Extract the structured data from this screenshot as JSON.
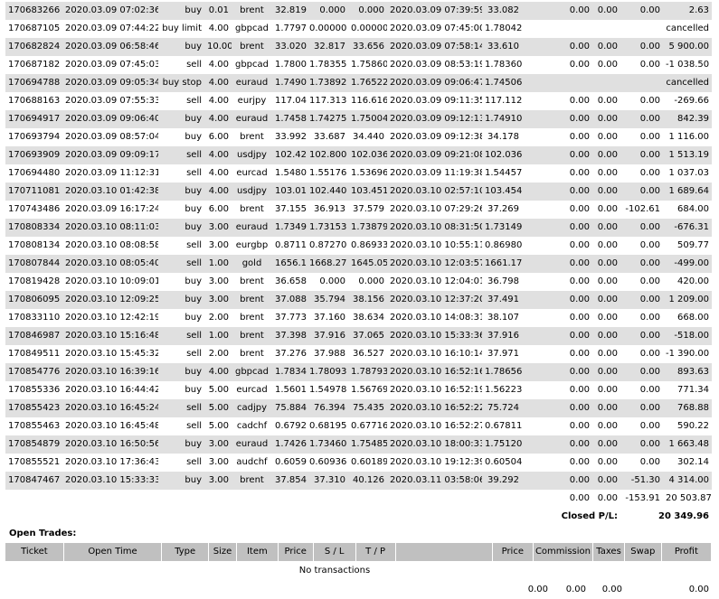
{
  "rows": [
    {
      "ticket": "170683266",
      "open_time": "2020.03.09 07:02:36",
      "type": "buy",
      "size": "0.01",
      "item": "brent",
      "price": "32.819",
      "sl": "0.000",
      "tp": "0.000",
      "close_time": "2020.03.09 07:39:59",
      "close_price": "33.082",
      "commission": "0.00",
      "taxes": "0.00",
      "swap": "0.00",
      "profit": "2.63"
    },
    {
      "ticket": "170687105",
      "open_time": "2020.03.09 07:44:22",
      "type": "buy limit",
      "size": "4.00",
      "item": "gbpcad",
      "price": "1.77979",
      "sl": "0.00000",
      "tp": "0.00000",
      "close_time": "2020.03.09 07:45:00",
      "close_price": "1.78042",
      "commission": "",
      "taxes": "",
      "swap": "",
      "profit": "cancelled"
    },
    {
      "ticket": "170682824",
      "open_time": "2020.03.09 06:58:46",
      "type": "buy",
      "size": "10.00",
      "item": "brent",
      "price": "33.020",
      "sl": "32.817",
      "tp": "33.656",
      "close_time": "2020.03.09 07:58:14",
      "close_price": "33.610",
      "commission": "0.00",
      "taxes": "0.00",
      "swap": "0.00",
      "profit": "5 900.00"
    },
    {
      "ticket": "170687182",
      "open_time": "2020.03.09 07:45:03",
      "type": "sell",
      "size": "4.00",
      "item": "gbpcad",
      "price": "1.78006",
      "sl": "1.78355",
      "tp": "1.75860",
      "close_time": "2020.03.09 08:53:19",
      "close_price": "1.78360",
      "commission": "0.00",
      "taxes": "0.00",
      "swap": "0.00",
      "profit": "-1 038.50"
    },
    {
      "ticket": "170694788",
      "open_time": "2020.03.09 09:05:34",
      "type": "buy stop",
      "size": "4.00",
      "item": "euraud",
      "price": "1.74900",
      "sl": "1.73892",
      "tp": "1.76522",
      "close_time": "2020.03.09 09:06:47",
      "close_price": "1.74506",
      "commission": "",
      "taxes": "",
      "swap": "",
      "profit": "cancelled"
    },
    {
      "ticket": "170688163",
      "open_time": "2020.03.09 07:55:33",
      "type": "sell",
      "size": "4.00",
      "item": "eurjpy",
      "price": "117.043",
      "sl": "117.313",
      "tp": "116.616",
      "close_time": "2020.03.09 09:11:35",
      "close_price": "117.112",
      "commission": "0.00",
      "taxes": "0.00",
      "swap": "0.00",
      "profit": "-269.66"
    },
    {
      "ticket": "170694917",
      "open_time": "2020.03.09 09:06:40",
      "type": "buy",
      "size": "4.00",
      "item": "euraud",
      "price": "1.74588",
      "sl": "1.74275",
      "tp": "1.75004",
      "close_time": "2020.03.09 09:12:13",
      "close_price": "1.74910",
      "commission": "0.00",
      "taxes": "0.00",
      "swap": "0.00",
      "profit": "842.39"
    },
    {
      "ticket": "170693794",
      "open_time": "2020.03.09 08:57:04",
      "type": "buy",
      "size": "6.00",
      "item": "brent",
      "price": "33.992",
      "sl": "33.687",
      "tp": "34.440",
      "close_time": "2020.03.09 09:12:38",
      "close_price": "34.178",
      "commission": "0.00",
      "taxes": "0.00",
      "swap": "0.00",
      "profit": "1 116.00"
    },
    {
      "ticket": "170693909",
      "open_time": "2020.03.09 09:09:17",
      "type": "sell",
      "size": "4.00",
      "item": "usdjpy",
      "price": "102.422",
      "sl": "102.800",
      "tp": "102.036",
      "close_time": "2020.03.09 09:21:08",
      "close_price": "102.036",
      "commission": "0.00",
      "taxes": "0.00",
      "swap": "0.00",
      "profit": "1 513.19"
    },
    {
      "ticket": "170694480",
      "open_time": "2020.03.09 11:12:31",
      "type": "sell",
      "size": "4.00",
      "item": "eurcad",
      "price": "1.54809",
      "sl": "1.55176",
      "tp": "1.53696",
      "close_time": "2020.03.09 11:19:38",
      "close_price": "1.54457",
      "commission": "0.00",
      "taxes": "0.00",
      "swap": "0.00",
      "profit": "1 037.03"
    },
    {
      "ticket": "170711081",
      "open_time": "2020.03.10 01:42:38",
      "type": "buy",
      "size": "4.00",
      "item": "usdjpy",
      "price": "103.017",
      "sl": "102.440",
      "tp": "103.451",
      "close_time": "2020.03.10 02:57:10",
      "close_price": "103.454",
      "commission": "0.00",
      "taxes": "0.00",
      "swap": "0.00",
      "profit": "1 689.64"
    },
    {
      "ticket": "170743486",
      "open_time": "2020.03.09 16:17:24",
      "type": "buy",
      "size": "6.00",
      "item": "brent",
      "price": "37.155",
      "sl": "36.913",
      "tp": "37.579",
      "close_time": "2020.03.10 07:29:26",
      "close_price": "37.269",
      "commission": "0.00",
      "taxes": "0.00",
      "swap": "-102.61",
      "profit": "684.00"
    },
    {
      "ticket": "170808334",
      "open_time": "2020.03.10 08:11:03",
      "type": "buy",
      "size": "3.00",
      "item": "euraud",
      "price": "1.73493",
      "sl": "1.73153",
      "tp": "1.73879",
      "close_time": "2020.03.10 08:31:50",
      "close_price": "1.73149",
      "commission": "0.00",
      "taxes": "0.00",
      "swap": "0.00",
      "profit": "-676.31"
    },
    {
      "ticket": "170808134",
      "open_time": "2020.03.10 08:08:58",
      "type": "sell",
      "size": "3.00",
      "item": "eurgbp",
      "price": "0.87110",
      "sl": "0.87270",
      "tp": "0.86933",
      "close_time": "2020.03.10 10:55:11",
      "close_price": "0.86980",
      "commission": "0.00",
      "taxes": "0.00",
      "swap": "0.00",
      "profit": "509.77"
    },
    {
      "ticket": "170807844",
      "open_time": "2020.03.10 08:05:40",
      "type": "sell",
      "size": "1.00",
      "item": "gold",
      "price": "1656.18",
      "sl": "1668.27",
      "tp": "1645.05",
      "close_time": "2020.03.10 12:03:57",
      "close_price": "1661.17",
      "commission": "0.00",
      "taxes": "0.00",
      "swap": "0.00",
      "profit": "-499.00"
    },
    {
      "ticket": "170819428",
      "open_time": "2020.03.10 10:09:01",
      "type": "buy",
      "size": "3.00",
      "item": "brent",
      "price": "36.658",
      "sl": "0.000",
      "tp": "0.000",
      "close_time": "2020.03.10 12:04:01",
      "close_price": "36.798",
      "commission": "0.00",
      "taxes": "0.00",
      "swap": "0.00",
      "profit": "420.00"
    },
    {
      "ticket": "170806095",
      "open_time": "2020.03.10 12:09:25",
      "type": "buy",
      "size": "3.00",
      "item": "brent",
      "price": "37.088",
      "sl": "35.794",
      "tp": "38.156",
      "close_time": "2020.03.10 12:37:20",
      "close_price": "37.491",
      "commission": "0.00",
      "taxes": "0.00",
      "swap": "0.00",
      "profit": "1 209.00"
    },
    {
      "ticket": "170833110",
      "open_time": "2020.03.10 12:42:19",
      "type": "buy",
      "size": "2.00",
      "item": "brent",
      "price": "37.773",
      "sl": "37.160",
      "tp": "38.634",
      "close_time": "2020.03.10 14:08:31",
      "close_price": "38.107",
      "commission": "0.00",
      "taxes": "0.00",
      "swap": "0.00",
      "profit": "668.00"
    },
    {
      "ticket": "170846987",
      "open_time": "2020.03.10 15:16:48",
      "type": "sell",
      "size": "1.00",
      "item": "brent",
      "price": "37.398",
      "sl": "37.916",
      "tp": "37.065",
      "close_time": "2020.03.10 15:33:36",
      "close_price": "37.916",
      "commission": "0.00",
      "taxes": "0.00",
      "swap": "0.00",
      "profit": "-518.00"
    },
    {
      "ticket": "170849511",
      "open_time": "2020.03.10 15:45:32",
      "type": "sell",
      "size": "2.00",
      "item": "brent",
      "price": "37.276",
      "sl": "37.988",
      "tp": "36.527",
      "close_time": "2020.03.10 16:10:14",
      "close_price": "37.971",
      "commission": "0.00",
      "taxes": "0.00",
      "swap": "0.00",
      "profit": "-1 390.00"
    },
    {
      "ticket": "170854776",
      "open_time": "2020.03.10 16:39:16",
      "type": "buy",
      "size": "4.00",
      "item": "gbpcad",
      "price": "1.78349",
      "sl": "1.78093",
      "tp": "1.78793",
      "close_time": "2020.03.10 16:52:16",
      "close_price": "1.78656",
      "commission": "0.00",
      "taxes": "0.00",
      "swap": "0.00",
      "profit": "893.63"
    },
    {
      "ticket": "170855336",
      "open_time": "2020.03.10 16:44:42",
      "type": "buy",
      "size": "5.00",
      "item": "eurcad",
      "price": "1.56011",
      "sl": "1.54978",
      "tp": "1.56769",
      "close_time": "2020.03.10 16:52:19",
      "close_price": "1.56223",
      "commission": "0.00",
      "taxes": "0.00",
      "swap": "0.00",
      "profit": "771.34"
    },
    {
      "ticket": "170855423",
      "open_time": "2020.03.10 16:45:24",
      "type": "sell",
      "size": "5.00",
      "item": "cadjpy",
      "price": "75.884",
      "sl": "76.394",
      "tp": "75.435",
      "close_time": "2020.03.10 16:52:22",
      "close_price": "75.724",
      "commission": "0.00",
      "taxes": "0.00",
      "swap": "0.00",
      "profit": "768.88"
    },
    {
      "ticket": "170855463",
      "open_time": "2020.03.10 16:45:48",
      "type": "sell",
      "size": "5.00",
      "item": "cadchf",
      "price": "0.67921",
      "sl": "0.68195",
      "tp": "0.67716",
      "close_time": "2020.03.10 16:52:27",
      "close_price": "0.67811",
      "commission": "0.00",
      "taxes": "0.00",
      "swap": "0.00",
      "profit": "590.22"
    },
    {
      "ticket": "170854879",
      "open_time": "2020.03.10 16:50:56",
      "type": "buy",
      "size": "3.00",
      "item": "euraud",
      "price": "1.74264",
      "sl": "1.73460",
      "tp": "1.75485",
      "close_time": "2020.03.10 18:00:33",
      "close_price": "1.75120",
      "commission": "0.00",
      "taxes": "0.00",
      "swap": "0.00",
      "profit": "1 663.48"
    },
    {
      "ticket": "170855521",
      "open_time": "2020.03.10 17:36:43",
      "type": "sell",
      "size": "3.00",
      "item": "audchf",
      "price": "0.60598",
      "sl": "0.60936",
      "tp": "0.60189",
      "close_time": "2020.03.10 19:12:39",
      "close_price": "0.60504",
      "commission": "0.00",
      "taxes": "0.00",
      "swap": "0.00",
      "profit": "302.14"
    },
    {
      "ticket": "170847467",
      "open_time": "2020.03.10 15:33:33",
      "type": "buy",
      "size": "3.00",
      "item": "brent",
      "price": "37.854",
      "sl": "37.310",
      "tp": "40.126",
      "close_time": "2020.03.11 03:58:06",
      "close_price": "39.292",
      "commission": "0.00",
      "taxes": "0.00",
      "swap": "-51.30",
      "profit": "4 314.00"
    }
  ],
  "totals": {
    "commission": "0.00",
    "taxes": "0.00",
    "swap": "-153.91",
    "profit": "20 503.87"
  },
  "closed_pl": {
    "label": "Closed P/L:",
    "value": "20 349.96"
  },
  "open_trades": {
    "title": "Open Trades:",
    "headers": {
      "ticket": "Ticket",
      "open_time": "Open Time",
      "type": "Type",
      "size": "Size",
      "item": "Item",
      "price": "Price",
      "sl": "S / L",
      "tp": "T / P",
      "blank": "",
      "close_price": "Price",
      "commission": "Commission",
      "taxes": "Taxes",
      "swap": "Swap",
      "profit": "Profit"
    },
    "empty_message": "No transactions",
    "totals": {
      "commission": "0.00",
      "taxes": "0.00",
      "swap": "0.00",
      "profit": "0.00"
    }
  }
}
